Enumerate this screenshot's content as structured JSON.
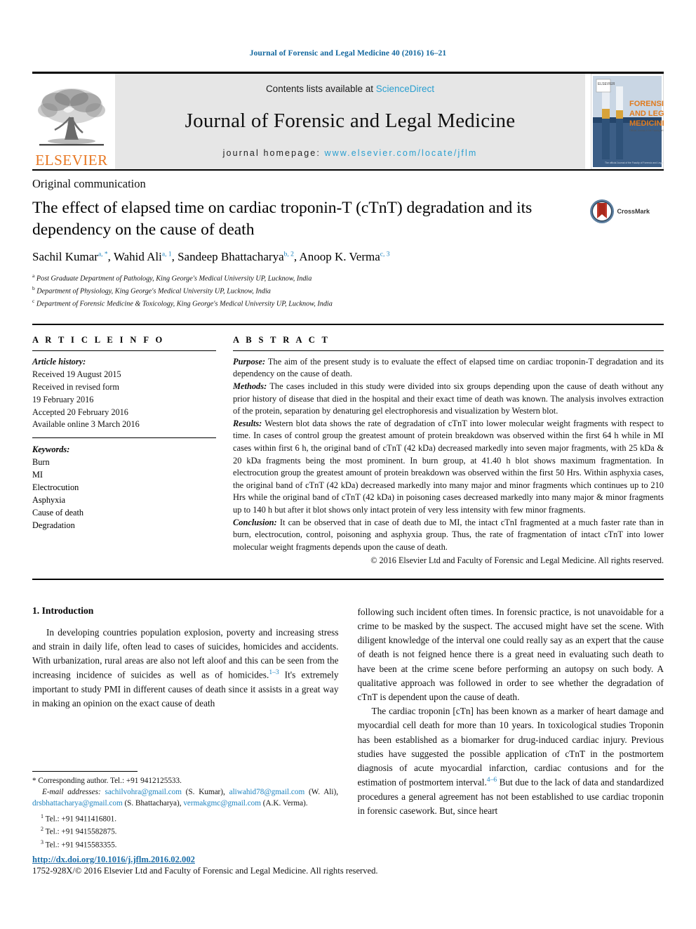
{
  "running_head": "Journal of Forensic and Legal Medicine 40 (2016) 16–21",
  "masthead": {
    "contents_prefix": "Contents lists available at ",
    "sciencedirect": "ScienceDirect",
    "journal_title": "Journal of Forensic and Legal Medicine",
    "homepage_label": "journal homepage: ",
    "homepage_url": "www.elsevier.com/locate/jflm",
    "publisher": "ELSEVIER",
    "cover_line1": "FORENSIC",
    "cover_line2": "AND LEGAL",
    "cover_line3": "MEDICINE"
  },
  "article": {
    "type": "Original communication",
    "title": "The effect of elapsed time on cardiac troponin-T (cTnT) degradation and its dependency on the cause of death",
    "crossmark_label": "CrossMark",
    "authors": [
      {
        "name": "Sachil Kumar",
        "marks": "a, *"
      },
      {
        "name": "Wahid Ali",
        "marks": "a, 1"
      },
      {
        "name": "Sandeep Bhattacharya",
        "marks": "b, 2"
      },
      {
        "name": "Anoop K. Verma",
        "marks": "c, 3"
      }
    ],
    "affiliations": [
      {
        "mark": "a",
        "text": "Post Graduate Department of Pathology, King George's Medical University UP, Lucknow, India"
      },
      {
        "mark": "b",
        "text": "Department of Physiology, King George's Medical University UP, Lucknow, India"
      },
      {
        "mark": "c",
        "text": "Department of Forensic Medicine & Toxicology, King George's Medical University UP, Lucknow, India"
      }
    ]
  },
  "article_info": {
    "heading": "A R T I C L E  I N F O",
    "history_label": "Article history:",
    "history": [
      "Received 19 August 2015",
      "Received in revised form",
      "19 February 2016",
      "Accepted 20 February 2016",
      "Available online 3 March 2016"
    ],
    "keywords_label": "Keywords:",
    "keywords": [
      "Burn",
      "MI",
      "Electrocution",
      "Asphyxia",
      "Cause of death",
      "Degradation"
    ]
  },
  "abstract": {
    "heading": "A B S T R A C T",
    "purpose_label": "Purpose:",
    "purpose": " The aim of the present study is to evaluate the effect of elapsed time on cardiac troponin-T degradation and its dependency on the cause of death.",
    "methods_label": "Methods:",
    "methods": " The cases included in this study were divided into six groups depending upon the cause of death without any prior history of disease that died in the hospital and their exact time of death was known. The analysis involves extraction of the protein, separation by denaturing gel electrophoresis and visualization by Western blot.",
    "results_label": "Results:",
    "results": " Western blot data shows the rate of degradation of cTnT into lower molecular weight fragments with respect to time. In cases of control group the greatest amount of protein breakdown was observed within the first 64 h while in MI cases within first 6 h, the original band of cTnT (42 kDa) decreased markedly into seven major fragments, with 25 kDa & 20 kDa fragments being the most prominent. In burn group, at 41.40 h blot shows maximum fragmentation. In electrocution group the greatest amount of protein breakdown was observed within the first 50 Hrs. Within asphyxia cases, the original band of cTnT (42 kDa) decreased markedly into many major and minor fragments which continues up to 210 Hrs while the original band of cTnT (42 kDa) in poisoning cases decreased markedly into many major & minor fragments up to 140 h but after it blot shows only intact protein of very less intensity with few minor fragments.",
    "conclusion_label": "Conclusion:",
    "conclusion": " It can be observed that in case of death due to MI, the intact cTnI fragmented at a much faster rate than in burn, electrocution, control, poisoning and asphyxia group. Thus, the rate of fragmentation of intact cTnT into lower molecular weight fragments depends upon the cause of death.",
    "copyright": "© 2016 Elsevier Ltd and Faculty of Forensic and Legal Medicine. All rights reserved."
  },
  "body": {
    "section_number_title": "1.  Introduction",
    "left_para_1a": "In developing countries population explosion, poverty and increasing stress and strain in daily life, often lead to cases of suicides, homicides and accidents. With urbanization, rural areas are also not left aloof and this can be seen from the increasing incidence of suicides as well as of homicides.",
    "left_ref_1": "1–3",
    "left_para_1b": " It's extremely important to study PMI in different causes of death since it assists in a great way in making an opinion on the exact cause of death",
    "right_para_1": "following such incident often times. In forensic practice, is not unavoidable for a crime to be masked by the suspect. The accused might have set the scene. With diligent knowledge of the interval one could really say as an expert that the cause of death is not feigned hence there is a great need in evaluating such death to have been at the crime scene before performing an autopsy on such body. A qualitative approach was followed in order to see whether the degradation of cTnT is dependent upon the cause of death.",
    "right_para_2a": "The cardiac troponin [cTn] has been known as a marker of heart damage and myocardial cell death for more than 10 years. In toxicological studies Troponin has been established as a biomarker for drug-induced cardiac injury. Previous studies have suggested the possible application of cTnT in the postmortem diagnosis of acute myocardial infarction, cardiac contusions and for the estimation of postmortem interval.",
    "right_ref_2": "4–6",
    "right_para_2b": " But due to the lack of data and standardized procedures a general agreement has not been established to use cardiac troponin in forensic casework. But, since heart"
  },
  "footnotes": {
    "corresponding": "Corresponding author. Tel.: +91 9412125533.",
    "email_label": "E-mail addresses:",
    "email_1": "sachilvohra@gmail.com",
    "email_1_who": " (S. Kumar), ",
    "email_2": "aliwahid78@gmail.com",
    "email_2_who": " (W. Ali), ",
    "email_3": "drsbhattacharya@gmail.com",
    "email_3_who": " (S. Bhattacharya), ",
    "email_4": "vermakgmc@gmail.com",
    "email_4_who": " (A.K. Verma).",
    "tels": [
      {
        "mark": "1",
        "text": "Tel.: +91 9411416801."
      },
      {
        "mark": "2",
        "text": "Tel.: +91 9415582875."
      },
      {
        "mark": "3",
        "text": "Tel.: +91 9415583355."
      }
    ]
  },
  "footer": {
    "doi": "http://dx.doi.org/10.1016/j.jflm.2016.02.002",
    "issn_line": "1752-928X/© 2016 Elsevier Ltd and Faculty of Forensic and Legal Medicine. All rights reserved."
  },
  "colors": {
    "link": "#1f84c0",
    "sciencedirect": "#2a9fd0",
    "elsevier_orange": "#E87722",
    "running_head": "#12679e"
  }
}
